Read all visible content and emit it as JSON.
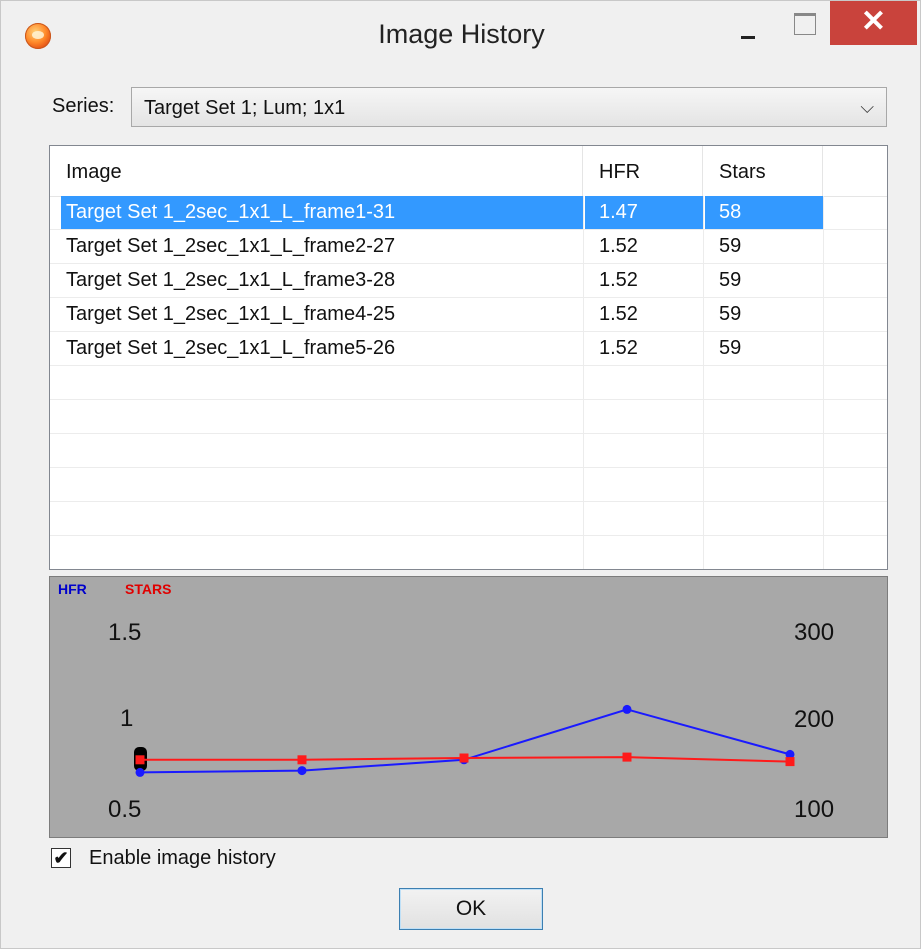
{
  "window": {
    "title": "Image History"
  },
  "series": {
    "label": "Series:",
    "value": "Target Set 1; Lum; 1x1"
  },
  "table": {
    "columns": [
      "Image",
      "HFR",
      "Stars"
    ],
    "rows": [
      {
        "image": "Target Set 1_2sec_1x1_L_frame1-31",
        "hfr": "1.47",
        "stars": "58"
      },
      {
        "image": "Target Set 1_2sec_1x1_L_frame2-27",
        "hfr": "1.52",
        "stars": "59"
      },
      {
        "image": "Target Set 1_2sec_1x1_L_frame3-28",
        "hfr": "1.52",
        "stars": "59"
      },
      {
        "image": "Target Set 1_2sec_1x1_L_frame4-25",
        "hfr": "1.52",
        "stars": "59"
      },
      {
        "image": "Target Set 1_2sec_1x1_L_frame5-26",
        "hfr": "1.52",
        "stars": "59"
      }
    ],
    "selected_index": 0
  },
  "chart_data": {
    "type": "line",
    "legend": [
      "HFR",
      "STARS"
    ],
    "x": [
      1,
      2,
      3,
      4,
      5
    ],
    "series": [
      {
        "name": "HFR",
        "axis": "left",
        "color": "#1a1aff",
        "values": [
          0.72,
          0.73,
          0.79,
          1.07,
          0.82
        ]
      },
      {
        "name": "STARS",
        "axis": "right",
        "color": "#ff1a1a",
        "values": [
          158,
          158,
          160,
          161,
          156
        ]
      }
    ],
    "y_left": {
      "ticks": [
        "1.5",
        "1",
        "0.5"
      ],
      "range": [
        0.5,
        1.5
      ]
    },
    "y_right": {
      "ticks": [
        "300",
        "200",
        "100"
      ],
      "range": [
        100,
        300
      ]
    },
    "colors": {
      "background": "#a8a8a8"
    }
  },
  "enable_history": {
    "label": "Enable image history",
    "checked": true,
    "check_glyph": "✔"
  },
  "ok_label": "OK"
}
